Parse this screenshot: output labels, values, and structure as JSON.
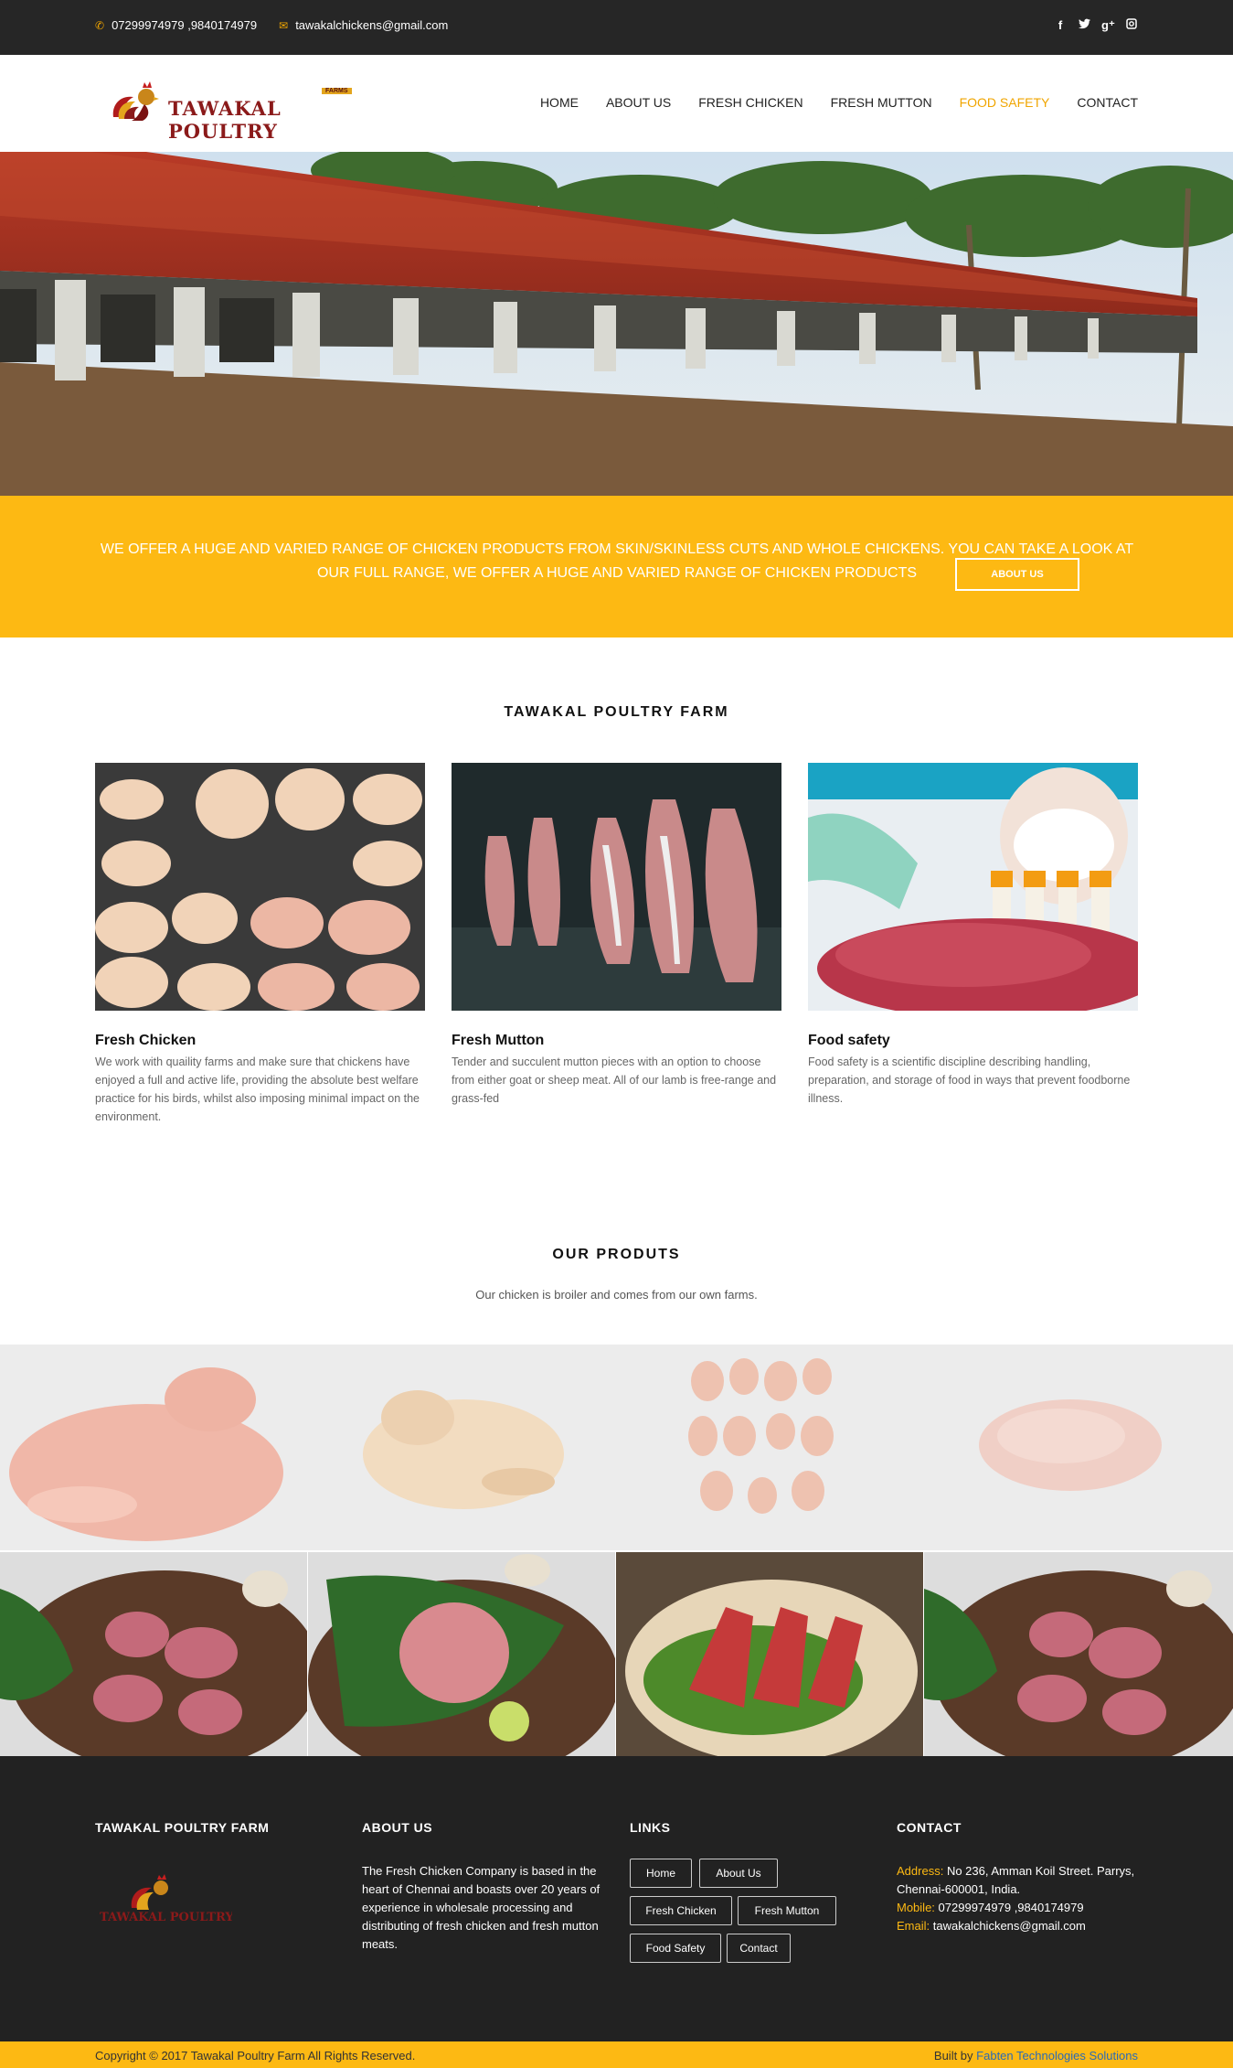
{
  "topbar": {
    "phone": "07299974979 ,9840174979",
    "email": "tawakalchickens@gmail.com",
    "social": [
      "f",
      "t",
      "g+",
      "ig"
    ]
  },
  "header": {
    "logo_text": "TAWAKAL POULTRY",
    "logo_badge": "FARMS",
    "nav": [
      "HOME",
      "ABOUT US",
      "FRESH CHICKEN",
      "FRESH MUTTON",
      "FOOD SAFETY",
      "CONTACT"
    ],
    "active_nav": "FOOD SAFETY"
  },
  "banner": {
    "text": "WE OFFER A HUGE AND VARIED RANGE OF CHICKEN PRODUCTS FROM SKIN/SKINLESS CUTS AND WHOLE CHICKENS. YOU CAN TAKE A LOOK AT OUR FULL RANGE, WE OFFER A HUGE AND VARIED RANGE OF CHICKEN PRODUCTS",
    "button": "ABOUT US"
  },
  "farm_section": {
    "title": "TAWAKAL POULTRY FARM",
    "cards": [
      {
        "title": "Fresh Chicken",
        "text": "We work with quaility farms and make sure that chickens have enjoyed a full and active life, providing the absolute best welfare practice for his birds, whilst also imposing minimal impact on the environment."
      },
      {
        "title": "Fresh Mutton",
        "text": "Tender and succulent mutton pieces with an option to choose from either goat or sheep meat. All of our lamb is free-range and grass-fed"
      },
      {
        "title": "Food safety",
        "text": "Food safety is a scientific discipline describing handling, preparation, and storage of food in ways that prevent foodborne illness."
      }
    ]
  },
  "products": {
    "title": "OUR PRODUTS",
    "subtitle": "Our chicken is broiler and comes from our own farms."
  },
  "footer": {
    "col1_title": "TAWAKAL POULTRY FARM",
    "col2_title": "ABOUT US",
    "about_text": "The Fresh Chicken Company is based in the heart of Chennai and boasts over 20 years of experience in wholesale processing and distributing of fresh chicken and fresh mutton meats.",
    "col3_title": "LINKS",
    "links": [
      "Home",
      "About Us",
      "Fresh Chicken",
      "Fresh Mutton",
      "Food Safety",
      "Contact"
    ],
    "col4_title": "CONTACT",
    "address_label": "Address:",
    "address": "No 236, Amman Koil Street. Parrys, Chennai-600001, India.",
    "mobile_label": "Mobile:",
    "mobile": "07299974979 ,9840174979",
    "email_label": "Email:",
    "email": "tawakalchickens@gmail.com",
    "copyright": "Copyright © 2017 Tawakal Poultry Farm All Rights Reserved.",
    "built_by_label": "Built by",
    "built_by": "Fabten Technologies Solutions"
  }
}
